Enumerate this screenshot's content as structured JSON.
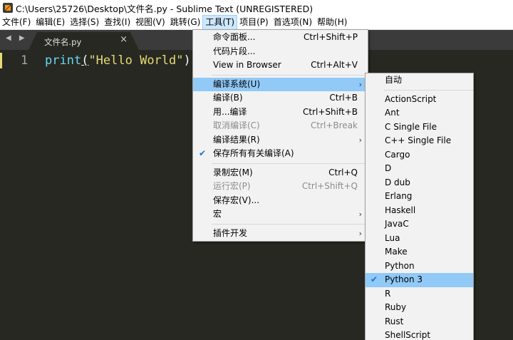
{
  "window": {
    "title": "C:\\Users\\25726\\Desktop\\文件名.py - Sublime Text (UNREGISTERED)"
  },
  "menubar": [
    "文件(F)",
    "编辑(E)",
    "选择(S)",
    "查找(I)",
    "视图(V)",
    "跳转(G)",
    "工具(T)",
    "项目(P)",
    "首选项(N)",
    "帮助(H)"
  ],
  "active_menu": "工具(T)",
  "tab": {
    "label": "文件名.py",
    "close": "×"
  },
  "editor": {
    "line_number": "1",
    "code_fn": "print",
    "code_open": "(",
    "code_str": "\"Hello World\"",
    "code_close": ")"
  },
  "tools_menu": [
    {
      "label": "命令面板...",
      "shortcut": "Ctrl+Shift+P"
    },
    {
      "label": "代码片段...",
      "shortcut": ""
    },
    {
      "label": "View in Browser",
      "shortcut": "Ctrl+Alt+V"
    },
    {
      "sep": true
    },
    {
      "label": "编译系统(U)",
      "submenu": true,
      "highlight": true
    },
    {
      "label": "编译(B)",
      "shortcut": "Ctrl+B"
    },
    {
      "label": "用...编译",
      "shortcut": "Ctrl+Shift+B"
    },
    {
      "label": "取消编译(C)",
      "shortcut": "Ctrl+Break",
      "disabled": true
    },
    {
      "label": "编译结果(R)",
      "submenu": true
    },
    {
      "label": "保存所有有关编译(A)",
      "checked": true
    },
    {
      "sep": true
    },
    {
      "label": "录制宏(M)",
      "shortcut": "Ctrl+Q"
    },
    {
      "label": "运行宏(P)",
      "shortcut": "Ctrl+Shift+Q",
      "disabled": true
    },
    {
      "label": "保存宏(V)...",
      "shortcut": ""
    },
    {
      "label": "宏",
      "submenu": true
    },
    {
      "sep": true
    },
    {
      "label": "插件开发",
      "submenu": true
    }
  ],
  "build_submenu": [
    {
      "label": "自动"
    },
    {
      "sep": true
    },
    {
      "label": "ActionScript"
    },
    {
      "label": "Ant"
    },
    {
      "label": "C Single File"
    },
    {
      "label": "C++ Single File"
    },
    {
      "label": "Cargo"
    },
    {
      "label": "D"
    },
    {
      "label": "D dub"
    },
    {
      "label": "Erlang"
    },
    {
      "label": "Haskell"
    },
    {
      "label": "JavaC"
    },
    {
      "label": "Lua"
    },
    {
      "label": "Make"
    },
    {
      "label": "Python"
    },
    {
      "label": "Python 3",
      "checked": true,
      "highlight": true
    },
    {
      "label": "R"
    },
    {
      "label": "Ruby"
    },
    {
      "label": "Rust"
    },
    {
      "label": "ShellScript"
    }
  ],
  "icons": {
    "check": "✔",
    "arrow": "›",
    "nav": "◀ ▶"
  }
}
